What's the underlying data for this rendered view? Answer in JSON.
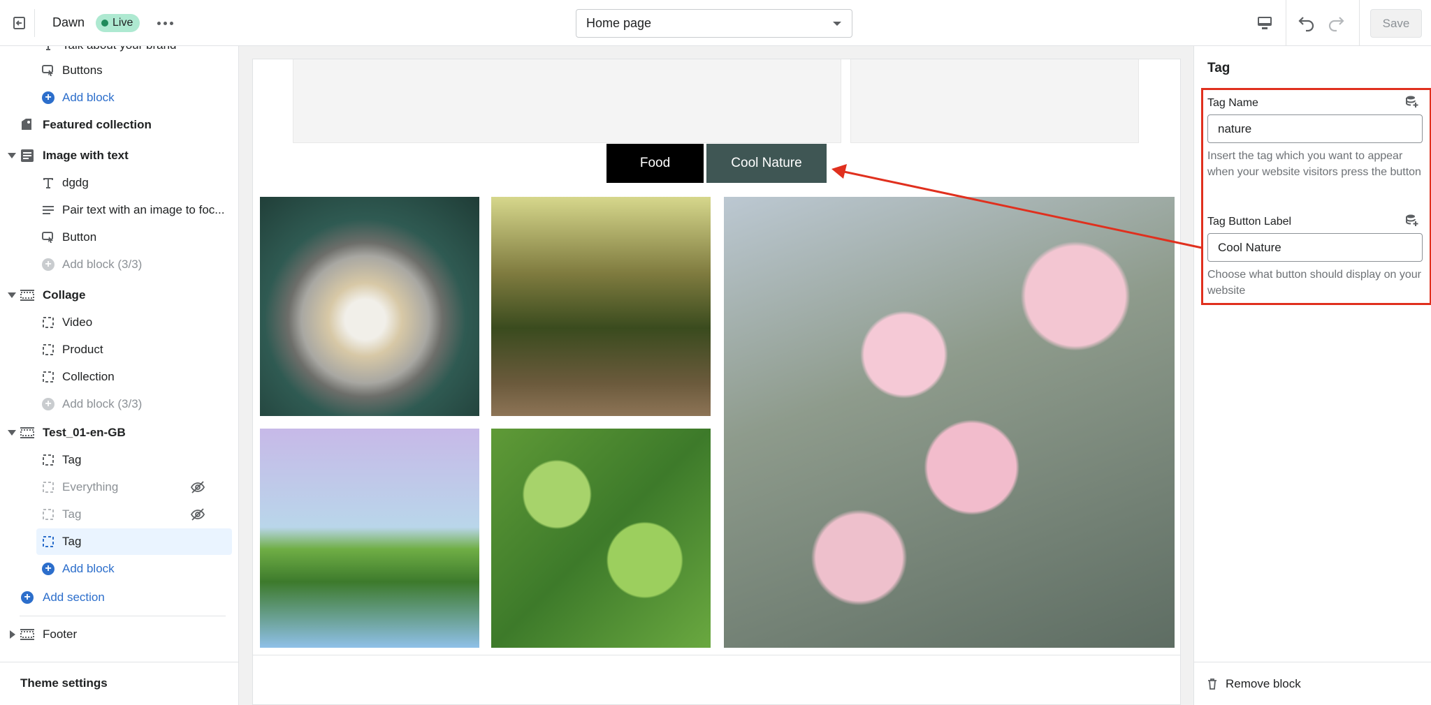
{
  "topbar": {
    "theme_name": "Dawn",
    "live_badge": "Live",
    "page_selector": "Home page",
    "save_label": "Save"
  },
  "sidebar": {
    "rows": [
      {
        "label": "Talk about your brand",
        "kind": "child",
        "icon": "text-icon"
      },
      {
        "label": "Buttons",
        "kind": "child",
        "icon": "button-icon"
      },
      {
        "label": "Add block",
        "kind": "add",
        "icon": "plus-circle-icon"
      },
      {
        "label": "Featured collection",
        "kind": "section",
        "icon": "collection-tag-icon"
      },
      {
        "label": "Image with text",
        "kind": "section",
        "icon": "image-text-icon"
      },
      {
        "label": "dgdg",
        "kind": "child",
        "icon": "heading-icon"
      },
      {
        "label": "Pair text with an image to foc...",
        "kind": "child",
        "icon": "paragraph-icon"
      },
      {
        "label": "Button",
        "kind": "child",
        "icon": "button-icon"
      },
      {
        "label": "Add block (3/3)",
        "kind": "add-disabled",
        "icon": "plus-circle-icon"
      },
      {
        "label": "Collage",
        "kind": "section",
        "icon": "layout-icon"
      },
      {
        "label": "Video",
        "kind": "child",
        "icon": "block-icon"
      },
      {
        "label": "Product",
        "kind": "child",
        "icon": "block-icon"
      },
      {
        "label": "Collection",
        "kind": "child",
        "icon": "block-icon"
      },
      {
        "label": "Add block (3/3)",
        "kind": "add-disabled",
        "icon": "plus-circle-icon"
      },
      {
        "label": "Test_01-en-GB",
        "kind": "section",
        "icon": "layout-icon"
      },
      {
        "label": "Tag",
        "kind": "child",
        "icon": "block-icon"
      },
      {
        "label": "Everything",
        "kind": "hidden",
        "icon": "block-icon"
      },
      {
        "label": "Tag",
        "kind": "hidden",
        "icon": "block-icon"
      },
      {
        "label": "Tag",
        "kind": "selected",
        "icon": "block-icon"
      },
      {
        "label": "Add block",
        "kind": "add",
        "icon": "plus-circle-icon"
      },
      {
        "label": "Add section",
        "kind": "add-section",
        "icon": "plus-circle-icon"
      },
      {
        "label": "Footer",
        "kind": "section-collapsed",
        "icon": "layout-icon"
      }
    ],
    "theme_settings": "Theme settings"
  },
  "preview": {
    "tag_buttons": [
      "Food",
      "Cool Nature"
    ]
  },
  "inspector": {
    "title": "Tag",
    "tag_name_label": "Tag Name",
    "tag_name_value": "nature",
    "tag_name_help": "Insert the tag which you want to appear when your website visitors press the button",
    "tag_button_label_label": "Tag Button Label",
    "tag_button_label_value": "Cool Nature",
    "tag_button_label_help": "Choose what button should display on your website",
    "remove_block": "Remove block"
  },
  "colors": {
    "accent_blue": "#2c6ecb",
    "live_badge_bg": "#aee9d1",
    "highlight_red": "#e0301e",
    "tag_food_bg": "#000000",
    "tag_nature_bg": "#3f5654"
  }
}
